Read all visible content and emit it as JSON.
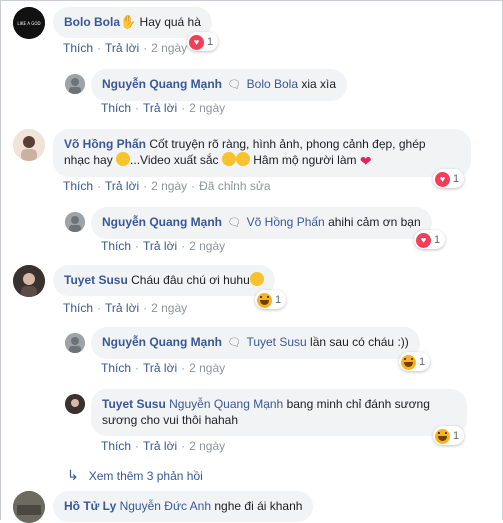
{
  "actions": {
    "like": "Thích",
    "reply": "Trả lời",
    "edited": "Đã chỉnh sửa"
  },
  "comments": [
    {
      "id": "c1",
      "author": "Bolo Bola",
      "suffix": "",
      "tag": "",
      "text": "Hay quá hà",
      "time": "2 ngày",
      "reaction": "love",
      "count": "1",
      "avatar_text": "LIKE A GOD"
    },
    {
      "id": "c2",
      "author": "Nguyễn Quang Mạnh",
      "tag": "Bolo Bola",
      "text": "xia xìa",
      "time": "2 ngày",
      "reaction": "",
      "count": ""
    },
    {
      "id": "c3",
      "author": "Võ Hồng Phấn",
      "text_line1": "Cốt truyện rõ ràng, hình ảnh, phong cảnh đẹp, ghép",
      "text_line2a": "nhạc hay ",
      "text_line2b": "...Video xuất sắc ",
      "text_line2c": " Hâm mộ người làm ",
      "time": "2 ngày",
      "reaction": "love",
      "count": "1"
    },
    {
      "id": "c4",
      "author": "Nguyễn Quang Mạnh",
      "tag": "Võ Hồng Phấn",
      "text": "ahihi cảm ơn bạn",
      "time": "2 ngày",
      "reaction": "love",
      "count": "1"
    },
    {
      "id": "c5",
      "author": "Tuyet Susu",
      "text": "Cháu đâu chú ơi huhu",
      "time": "2 ngày",
      "reaction": "haha",
      "count": "1"
    },
    {
      "id": "c6",
      "author": "Nguyễn Quang Mạnh",
      "tag": "Tuyet Susu",
      "text": "lần sau có cháu :))",
      "time": "2 ngày",
      "reaction": "haha",
      "count": "1"
    },
    {
      "id": "c7",
      "author": "Tuyet Susu",
      "tag": "Nguyễn Quang Mạnh",
      "text_line1": "bang minh chỉ đánh sương",
      "text_line2": "sương cho vui thôi hahah",
      "time": "2 ngày",
      "reaction": "haha",
      "count": "1"
    },
    {
      "id": "c8",
      "author": "Hồ Tử Ly",
      "tag": "Nguyễn Đức Anh",
      "text": "nghe đi ái khanh"
    }
  ],
  "view_more": "Xem thêm 3 phản hồi",
  "colors": {
    "link": "#385898",
    "bubble": "#f2f3f5",
    "meta": "#90949c",
    "love": "#f33e58",
    "haha": "#f7b125"
  }
}
